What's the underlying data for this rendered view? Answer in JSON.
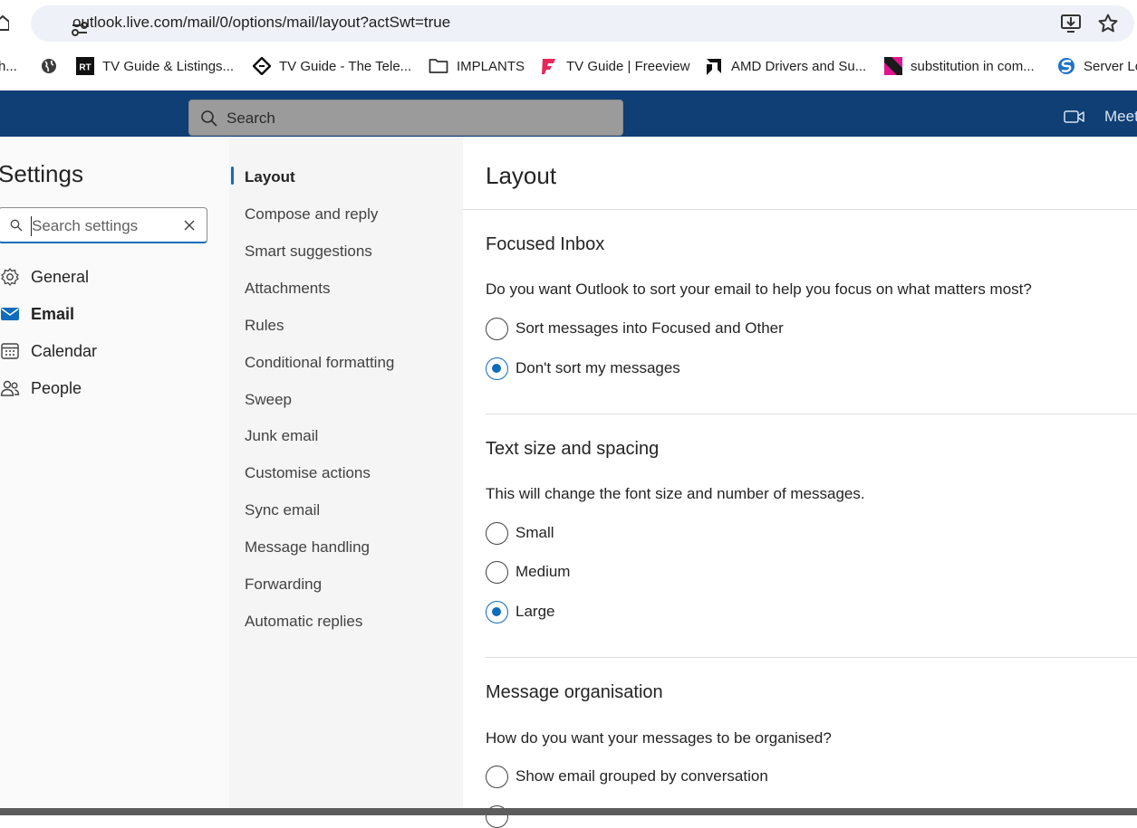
{
  "browser": {
    "url": "outlook.live.com/mail/0/options/mail/layout?actSwt=true",
    "bookmarks": [
      {
        "label": "h...",
        "icon": "truncated-bookmark"
      },
      {
        "label": "",
        "icon": "globe-icon"
      },
      {
        "label": "TV Guide & Listings...",
        "icon": "rt-logo-icon"
      },
      {
        "label": "TV Guide - The Tele...",
        "icon": "telegraph-logo-icon"
      },
      {
        "label": "IMPLANTS",
        "icon": "folder-icon"
      },
      {
        "label": "TV Guide | Freeview",
        "icon": "freeview-logo-icon"
      },
      {
        "label": "AMD Drivers and Su...",
        "icon": "amd-logo-icon"
      },
      {
        "label": "substitution in com...",
        "icon": "magenta-square-icon"
      },
      {
        "label": "Server Lo",
        "icon": "server-logo-icon"
      }
    ]
  },
  "header": {
    "search_label": "Search",
    "meet_label": "Meet"
  },
  "settings": {
    "title": "Settings",
    "search_placeholder": "Search settings",
    "categories": [
      {
        "label": "General",
        "icon": "gear-icon"
      },
      {
        "label": "Email",
        "icon": "mail-icon",
        "active": true
      },
      {
        "label": "Calendar",
        "icon": "calendar-icon"
      },
      {
        "label": "People",
        "icon": "people-icon"
      }
    ]
  },
  "subnav": {
    "items": [
      "Layout",
      "Compose and reply",
      "Smart suggestions",
      "Attachments",
      "Rules",
      "Conditional formatting",
      "Sweep",
      "Junk email",
      "Customise actions",
      "Sync email",
      "Message handling",
      "Forwarding",
      "Automatic replies"
    ],
    "active": "Layout"
  },
  "main": {
    "title": "Layout",
    "focused_inbox": {
      "title": "Focused Inbox",
      "question": "Do you want Outlook to sort your email to help you focus on what matters most?",
      "options": [
        "Sort messages into Focused and Other",
        "Don't sort my messages"
      ],
      "selected": "Don't sort my messages"
    },
    "text_size": {
      "title": "Text size and spacing",
      "question": "This will change the font size and number of messages.",
      "options": [
        "Small",
        "Medium",
        "Large"
      ],
      "selected": "Large"
    },
    "organisation": {
      "title": "Message organisation",
      "question": "How do you want your messages to be organised?",
      "options": [
        "Show email grouped by conversation"
      ]
    }
  },
  "colors": {
    "header_bg": "#0f3f74",
    "accent": "#0f6cbd"
  }
}
